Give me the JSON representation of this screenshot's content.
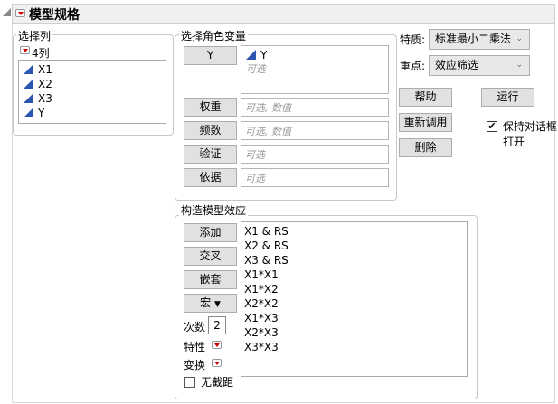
{
  "title": "模型规格",
  "select_columns": {
    "label": "选择列",
    "count": "4列",
    "columns": [
      "X1",
      "X2",
      "X3",
      "Y"
    ]
  },
  "roles": {
    "label": "选择角色变量",
    "y_button": "Y",
    "y_values": [
      "Y"
    ],
    "y_placeholder": "可选",
    "rows": [
      {
        "button": "权重",
        "placeholder": "可选, 数值"
      },
      {
        "button": "频数",
        "placeholder": "可选, 数值"
      },
      {
        "button": "验证",
        "placeholder": "可选"
      },
      {
        "button": "依据",
        "placeholder": "可选"
      }
    ]
  },
  "personality": {
    "label": "特质:",
    "value": "标准最小二乘法"
  },
  "emphasis": {
    "label": "重点:",
    "value": "效应筛选"
  },
  "actions": {
    "help": "帮助",
    "run": "运行",
    "recall": "重新调用",
    "remove": "删除",
    "keep_open": "保持对话框打开",
    "keep_open_checked": true
  },
  "effects": {
    "label": "构造模型效应",
    "add": "添加",
    "cross": "交叉",
    "nest": "嵌套",
    "macros": "宏",
    "degree_label": "次数",
    "degree": "2",
    "attributes": "特性",
    "transform": "变换",
    "no_intercept": "无截距",
    "no_intercept_checked": false,
    "items": [
      "X1 & RS",
      "X2 & RS",
      "X3 & RS",
      "X1*X1",
      "X1*X2",
      "X2*X2",
      "X1*X3",
      "X2*X3",
      "X3*X3"
    ]
  },
  "colors": {
    "menu_red": "#cc0000",
    "continuous_icon": "#2a56b0"
  }
}
